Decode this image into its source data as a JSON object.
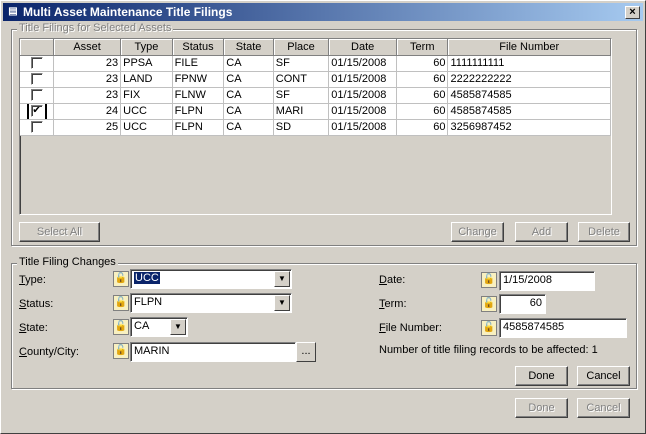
{
  "window": {
    "title": "Multi Asset Maintenance Title Filings",
    "close_label": "×"
  },
  "filings": {
    "group_label": "Title Filings for Selected Assets",
    "columns": [
      "",
      "Asset",
      "Type",
      "Status",
      "State",
      "Place",
      "Date",
      "Term",
      "File Number"
    ],
    "rows": [
      {
        "checked": "",
        "asset": "23",
        "type": "PPSA",
        "status": "FILE",
        "state": "CA",
        "place": "SF",
        "date": "01/15/2008",
        "term": "60",
        "file": "1111111111"
      },
      {
        "checked": "",
        "asset": "23",
        "type": "LAND",
        "status": "FPNW",
        "state": "CA",
        "place": "CONT",
        "date": "01/15/2008",
        "term": "60",
        "file": "2222222222"
      },
      {
        "checked": "",
        "asset": "23",
        "type": "FIX",
        "status": "FLNW",
        "state": "CA",
        "place": "SF",
        "date": "01/15/2008",
        "term": "60",
        "file": "4585874585"
      },
      {
        "checked": "✔",
        "asset": "24",
        "type": "UCC",
        "status": "FLPN",
        "state": "CA",
        "place": "MARI",
        "date": "01/15/2008",
        "term": "60",
        "file": "4585874585"
      },
      {
        "checked": "",
        "asset": "25",
        "type": "UCC",
        "status": "FLPN",
        "state": "CA",
        "place": "SD",
        "date": "01/15/2008",
        "term": "60",
        "file": "3256987452"
      }
    ],
    "buttons": {
      "select_all": "Select All",
      "change": "Change",
      "add": "Add",
      "delete": "Delete"
    }
  },
  "changes": {
    "group_label": "Title Filing Changes",
    "type": {
      "label_u": "T",
      "label_rest": "ype:",
      "value": "UCC"
    },
    "status": {
      "label_u": "S",
      "label_rest": "tatus:",
      "value": "FLPN"
    },
    "state": {
      "label_u": "S",
      "label_rest": "tate:",
      "value": "CA"
    },
    "county": {
      "label_u": "C",
      "label_rest": "ounty/City:",
      "value": "MARIN",
      "ellipsis": "..."
    },
    "date": {
      "label_u": "D",
      "label_rest": "ate:",
      "value": "1/15/2008"
    },
    "term": {
      "label_u": "T",
      "label_rest": "erm:",
      "value": "60"
    },
    "file_number": {
      "label_u": "F",
      "label_rest": "ile Number:",
      "value": "4585874585"
    },
    "affected": {
      "text": "Number of title filing records to be affected:",
      "count": "1"
    },
    "done": "Done",
    "cancel": "Cancel"
  },
  "footer": {
    "done": "Done",
    "cancel": "Cancel"
  },
  "icons": {
    "lock": "lock-icon",
    "dropdown": "▼"
  }
}
